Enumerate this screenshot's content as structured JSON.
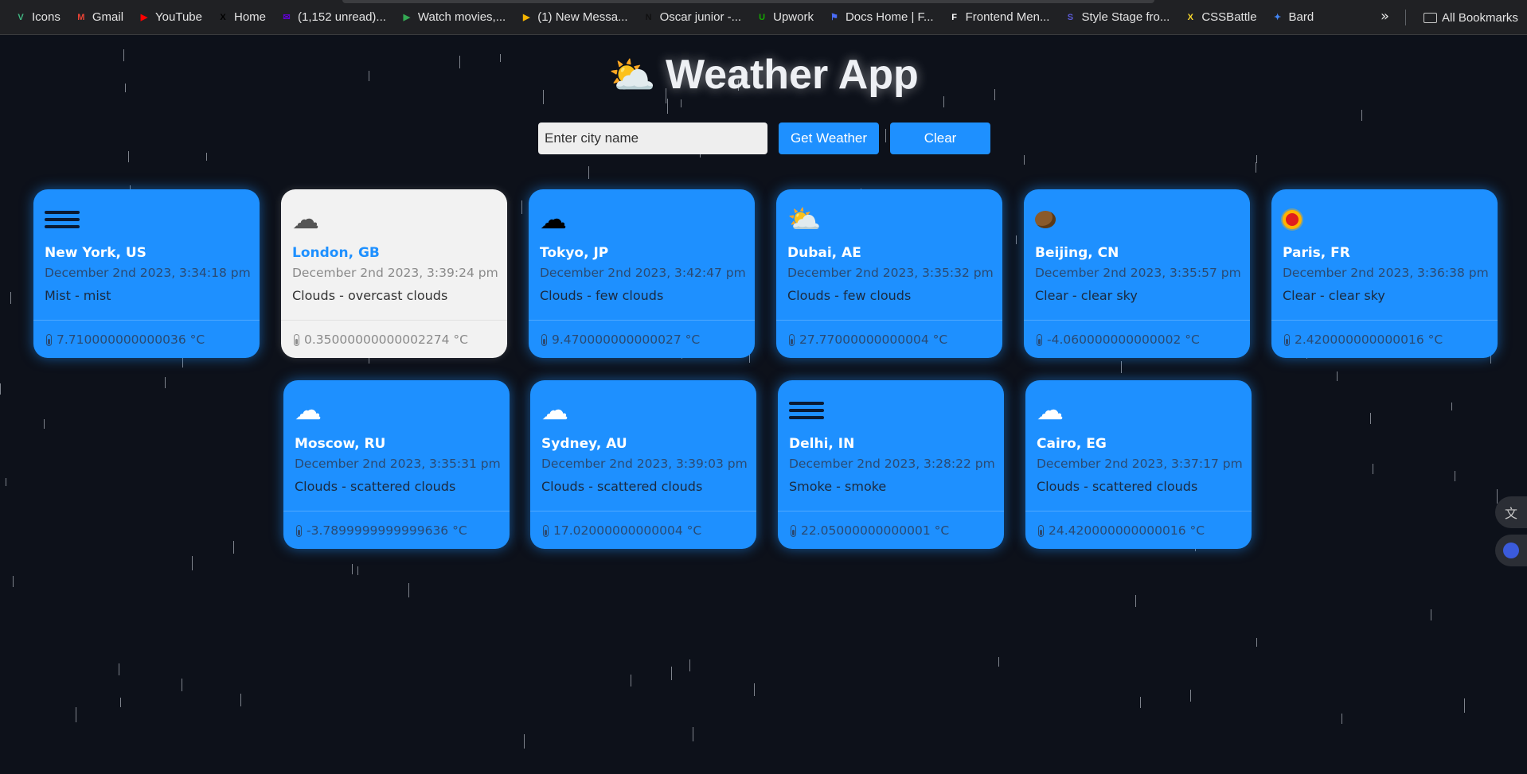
{
  "bookmarks": [
    {
      "label": "Icons",
      "fav": "V",
      "color": "#41b883"
    },
    {
      "label": "Gmail",
      "fav": "M",
      "color": "#ea4335"
    },
    {
      "label": "YouTube",
      "fav": "▶",
      "color": "#ff0000"
    },
    {
      "label": "Home",
      "fav": "X",
      "color": "#000000"
    },
    {
      "label": "(1,152 unread)...",
      "fav": "✉",
      "color": "#6001d2"
    },
    {
      "label": "Watch movies,...",
      "fav": "▶",
      "color": "#34a853"
    },
    {
      "label": "(1) New Messa...",
      "fav": "▶",
      "color": "#f4b400"
    },
    {
      "label": "Oscar junior -...",
      "fav": "N",
      "color": "#111111"
    },
    {
      "label": "Upwork",
      "fav": "U",
      "color": "#14a800"
    },
    {
      "label": "Docs Home | F...",
      "fav": "⚑",
      "color": "#4a6cf7"
    },
    {
      "label": "Frontend Men...",
      "fav": "F",
      "color": "#ffffff"
    },
    {
      "label": "Style Stage fro...",
      "fav": "S",
      "color": "#5b5bd6"
    },
    {
      "label": "CSSBattle",
      "fav": "X",
      "color": "#f9d72c"
    },
    {
      "label": "Bard",
      "fav": "✦",
      "color": "#4285f4"
    }
  ],
  "bookmarks_more": "»",
  "all_bookmarks": "All Bookmarks",
  "app": {
    "title": "Weather App",
    "title_icon": "⛅"
  },
  "search": {
    "placeholder": "Enter city name",
    "value": "",
    "get_label": "Get Weather",
    "clear_label": "Clear"
  },
  "cards": [
    {
      "city": "New York, US",
      "date": "December 2nd 2023, 3:34:18 pm",
      "desc": "Mist - mist",
      "temp": "7.710000000000036 °C",
      "icon": "mist-icon"
    },
    {
      "city": "London, GB",
      "date": "December 2nd 2023, 3:39:24 pm",
      "desc": "Clouds - overcast clouds",
      "temp": "0.35000000000002274 °C",
      "icon": "overcast-clouds-icon"
    },
    {
      "city": "Tokyo, JP",
      "date": "December 2nd 2023, 3:42:47 pm",
      "desc": "Clouds - few clouds",
      "temp": "9.470000000000027 °C",
      "icon": "few-clouds-night-icon"
    },
    {
      "city": "Dubai, AE",
      "date": "December 2nd 2023, 3:35:32 pm",
      "desc": "Clouds - few clouds",
      "temp": "27.77000000000004 °C",
      "icon": "few-clouds-day-icon"
    },
    {
      "city": "Beijing, CN",
      "date": "December 2nd 2023, 3:35:57 pm",
      "desc": "Clear - clear sky",
      "temp": "-4.060000000000002 °C",
      "icon": "clear-night-icon"
    },
    {
      "city": "Paris, FR",
      "date": "December 2nd 2023, 3:36:38 pm",
      "desc": "Clear - clear sky",
      "temp": "2.420000000000016 °C",
      "icon": "clear-day-icon"
    },
    {
      "city": "Moscow, RU",
      "date": "December 2nd 2023, 3:35:31 pm",
      "desc": "Clouds - scattered clouds",
      "temp": "-3.7899999999999636 °C",
      "icon": "scattered-clouds-icon"
    },
    {
      "city": "Sydney, AU",
      "date": "December 2nd 2023, 3:39:03 pm",
      "desc": "Clouds - scattered clouds",
      "temp": "17.02000000000004 °C",
      "icon": "scattered-clouds-icon"
    },
    {
      "city": "Delhi, IN",
      "date": "December 2nd 2023, 3:28:22 pm",
      "desc": "Smoke - smoke",
      "temp": "22.05000000000001 °C",
      "icon": "smoke-icon"
    },
    {
      "city": "Cairo, EG",
      "date": "December 2nd 2023, 3:37:17 pm",
      "desc": "Clouds - scattered clouds",
      "temp": "24.420000000000016 °C",
      "icon": "scattered-clouds-icon"
    }
  ],
  "colors": {
    "card_blue": "#1e90ff",
    "card_light": "#f2f2f2",
    "background": "#0d111a"
  }
}
